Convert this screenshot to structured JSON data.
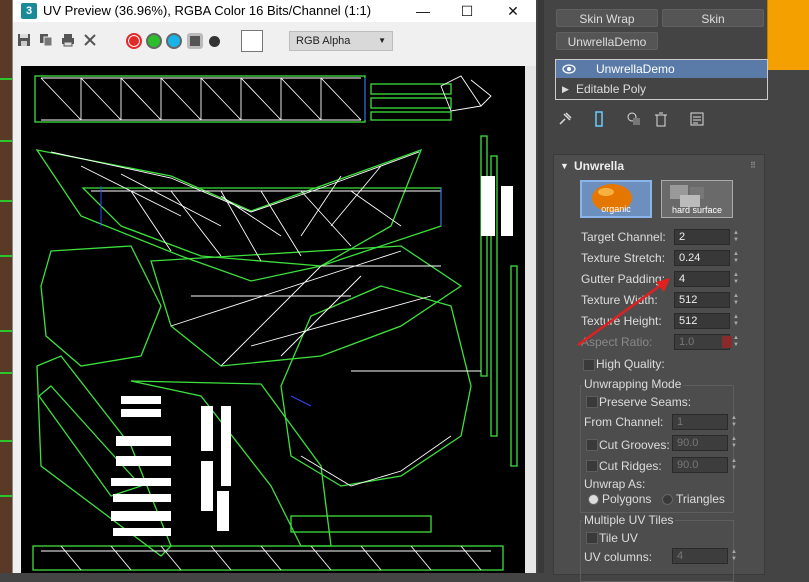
{
  "window": {
    "app_icon": "3",
    "title": "UV Preview (36.96%), RGBA Color 16 Bits/Channel (1:1)",
    "minimize": "—",
    "maximize": "☐",
    "close": "✕"
  },
  "toolbar": {
    "icons": [
      "save-icon",
      "copy-icon",
      "print-icon",
      "clear-icon"
    ],
    "channel_colors": {
      "red": "#e12b2b",
      "green": "#2bbf2b",
      "blue": "#18b3e8"
    },
    "display_channel": "RGB Alpha"
  },
  "modifier_buttons": {
    "skin_wrap": "Skin Wrap",
    "skin": "Skin",
    "unwrella_demo": "UnwrellaDemo"
  },
  "stack": {
    "item1": "UnwrellaDemo",
    "item2": "Editable Poly"
  },
  "rollout": {
    "title": "Unwrella",
    "organic_label": "organic",
    "hard_label": "hard surface",
    "target_channel": {
      "label": "Target Channel:",
      "value": "2"
    },
    "texture_stretch": {
      "label": "Texture Stretch:",
      "value": "0.24"
    },
    "gutter_padding": {
      "label": "Gutter Padding:",
      "value": "4"
    },
    "texture_width": {
      "label": "Texture Width:",
      "value": "512"
    },
    "texture_height": {
      "label": "Texture Height:",
      "value": "512"
    },
    "aspect_ratio": {
      "label": "Aspect Ratio:",
      "value": "1.0"
    },
    "high_quality": "High Quality:",
    "unwrapping_mode": {
      "title": "Unwrapping Mode",
      "preserve_seams": "Preserve Seams:",
      "from_channel": {
        "label": "From Channel:",
        "value": "1"
      },
      "cut_grooves": {
        "label": "Cut Grooves:",
        "value": "90.0"
      },
      "cut_ridges": {
        "label": "Cut Ridges:",
        "value": "90.0"
      },
      "unwrap_as": "Unwrap As:",
      "polygons": "Polygons",
      "triangles": "Triangles"
    },
    "uv_tiles": {
      "title": "Multiple UV Tiles",
      "tile_uv": "Tile UV",
      "uv_columns": {
        "label": "UV columns:",
        "value": "4"
      }
    }
  }
}
